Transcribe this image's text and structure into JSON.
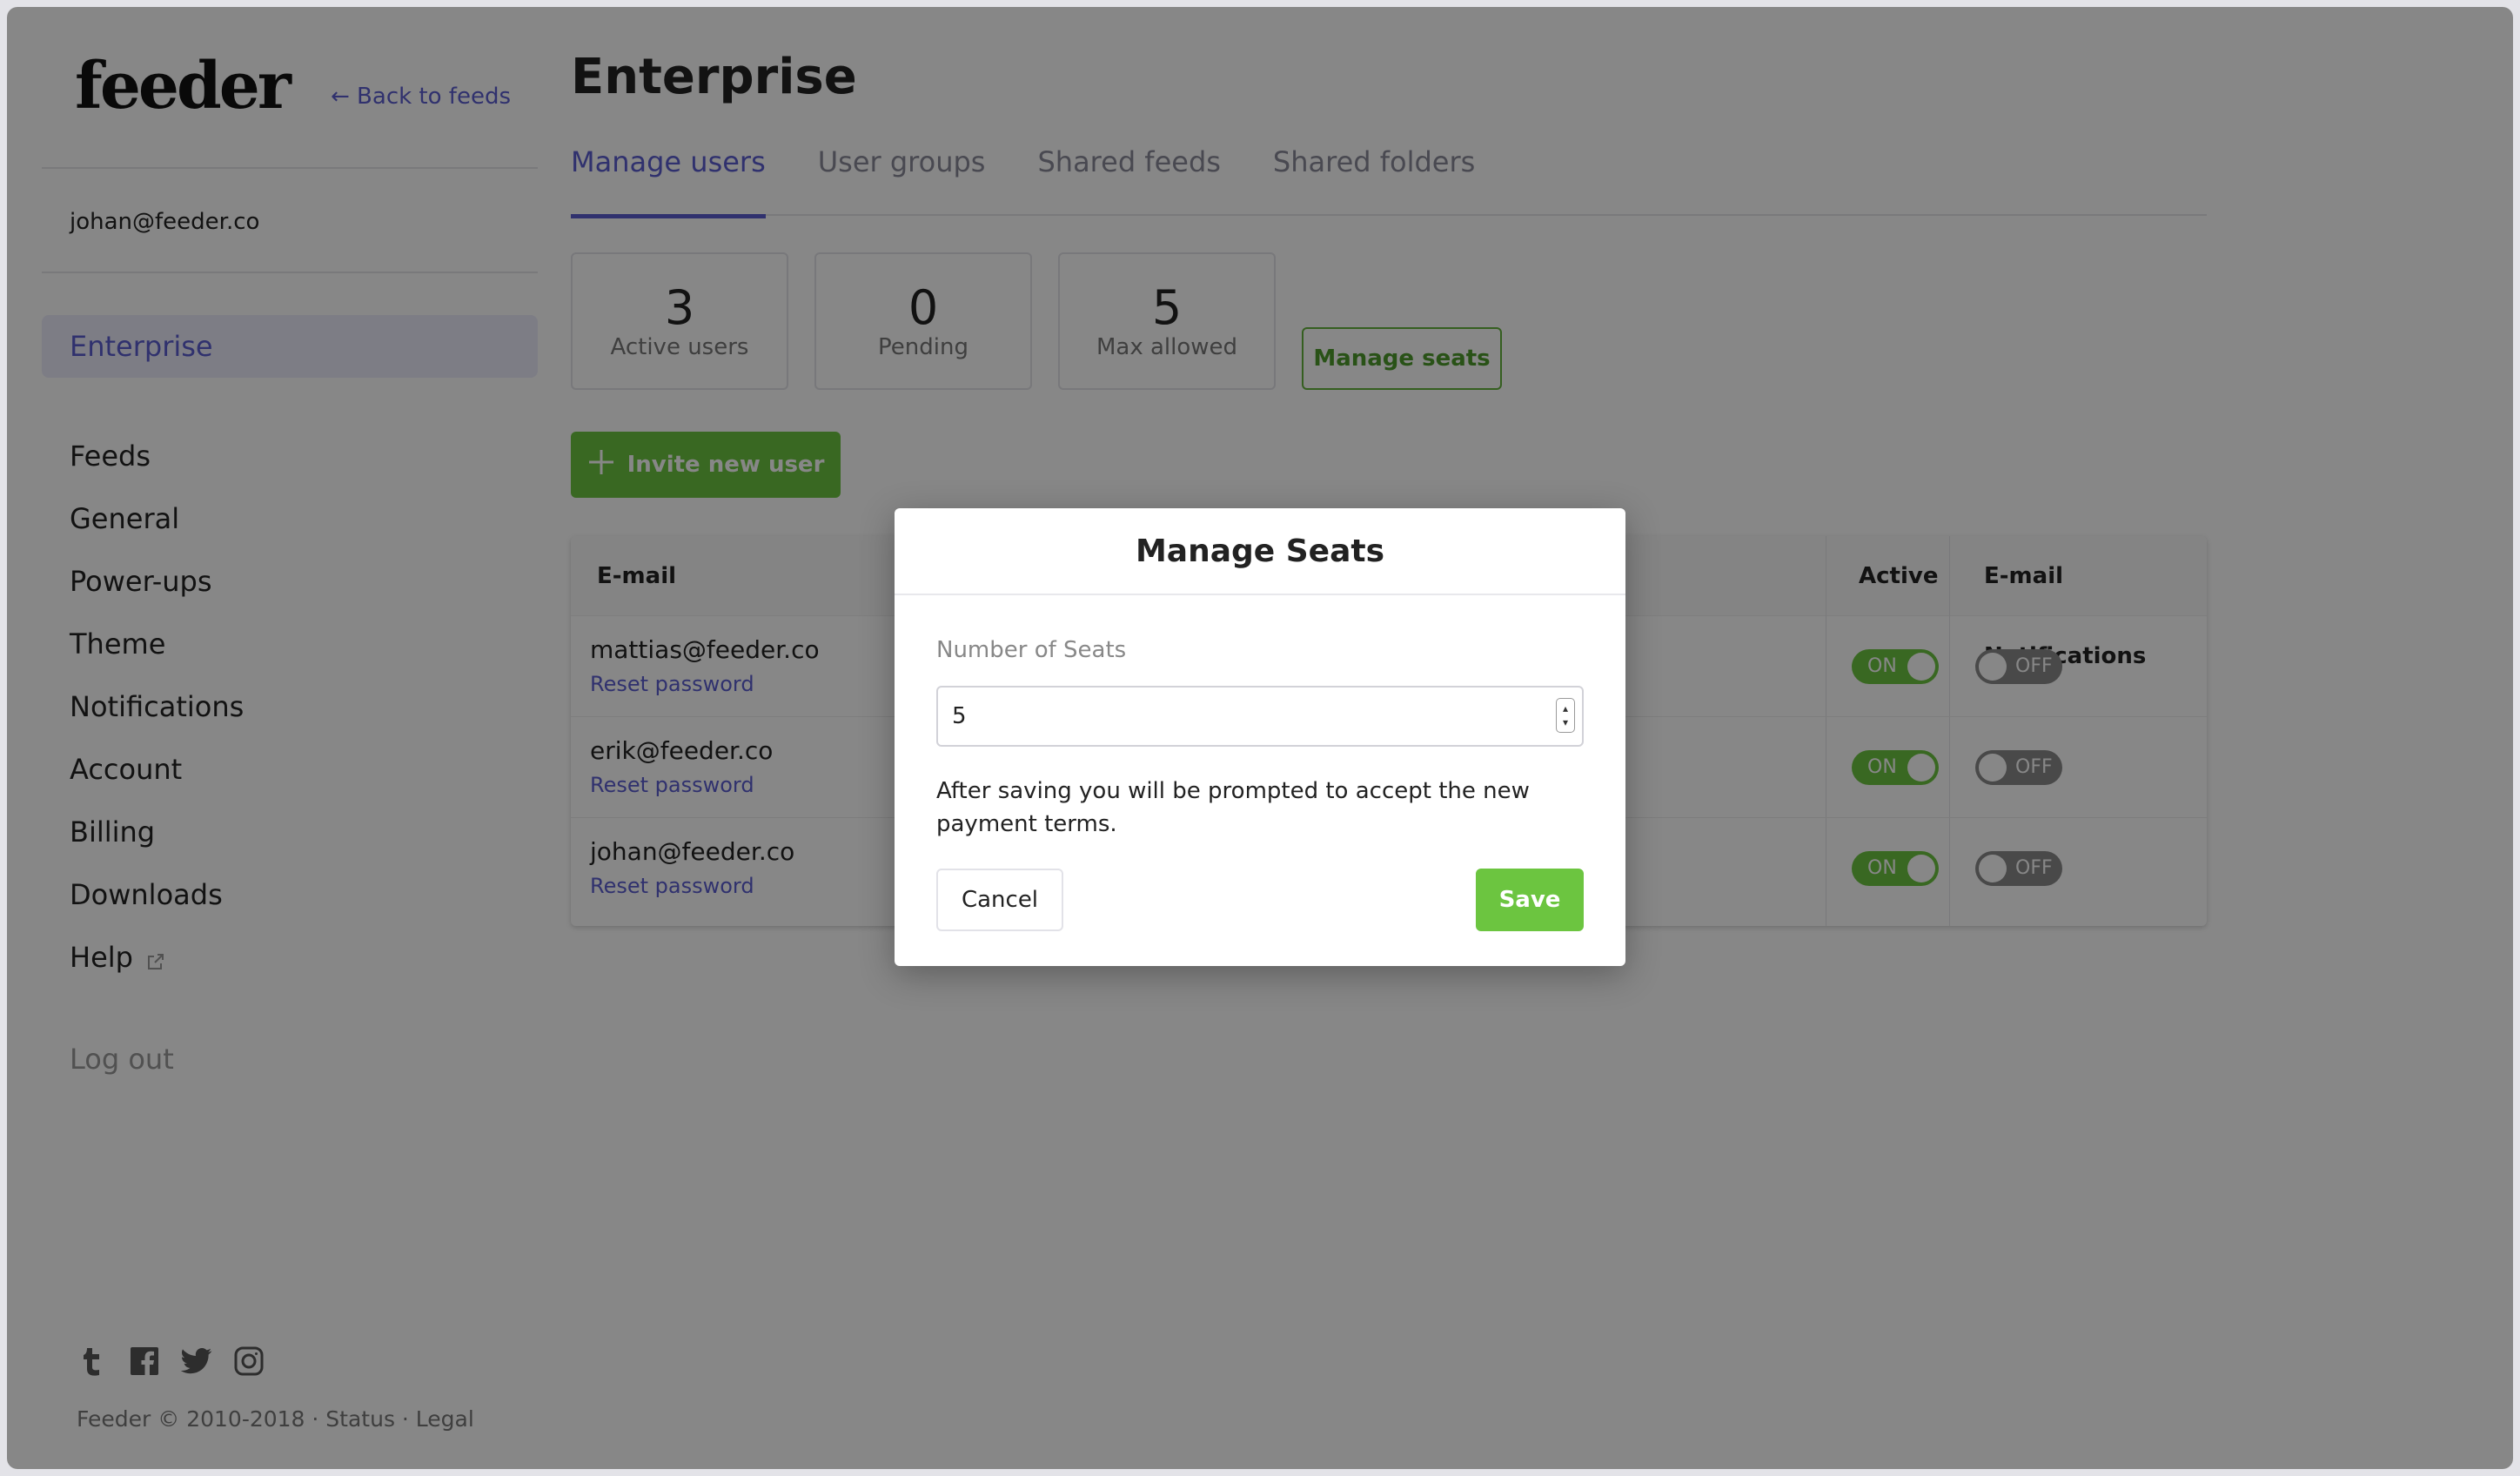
{
  "sidebar": {
    "logo": "feeder",
    "back_link": "← Back to feeds",
    "user_email": "johan@feeder.co",
    "active_item": "Enterprise",
    "items": [
      {
        "label": "Feeds"
      },
      {
        "label": "General"
      },
      {
        "label": "Power-ups"
      },
      {
        "label": "Theme"
      },
      {
        "label": "Notifications"
      },
      {
        "label": "Account"
      },
      {
        "label": "Billing"
      },
      {
        "label": "Downloads"
      },
      {
        "label": "Help"
      }
    ],
    "logout": "Log out",
    "social_icons": [
      "tumblr-icon",
      "facebook-icon",
      "twitter-icon",
      "instagram-icon"
    ],
    "footer": "Feeder © 2010-2018 · Status · Legal"
  },
  "main": {
    "title": "Enterprise",
    "tabs": [
      {
        "label": "Manage users",
        "active": true
      },
      {
        "label": "User groups",
        "active": false
      },
      {
        "label": "Shared feeds",
        "active": false
      },
      {
        "label": "Shared folders",
        "active": false
      }
    ],
    "stats": [
      {
        "value": "3",
        "label": "Active users"
      },
      {
        "value": "0",
        "label": "Pending"
      },
      {
        "value": "5",
        "label": "Max allowed"
      }
    ],
    "manage_seats_label": "Manage seats",
    "invite_label": "Invite new user",
    "table": {
      "headers": {
        "email": "E-mail",
        "active": "Active",
        "notifications": "E-mail Notifications"
      },
      "reset_label": "Reset password",
      "rows": [
        {
          "email": "mattias@feeder.co",
          "active": "ON",
          "notifications": "OFF"
        },
        {
          "email": "erik@feeder.co",
          "active": "ON",
          "notifications": "OFF"
        },
        {
          "email": "johan@feeder.co",
          "active": "ON",
          "notifications": "OFF"
        }
      ]
    }
  },
  "modal": {
    "title": "Manage Seats",
    "field_label": "Number of Seats",
    "field_value": "5",
    "message": "After saving you will be prompted to accept the new payment terms.",
    "cancel_label": "Cancel",
    "save_label": "Save"
  },
  "colors": {
    "accent": "#5b5ed0",
    "success": "#6cc540",
    "overlay": "rgba(0,0,0,0.47)"
  }
}
